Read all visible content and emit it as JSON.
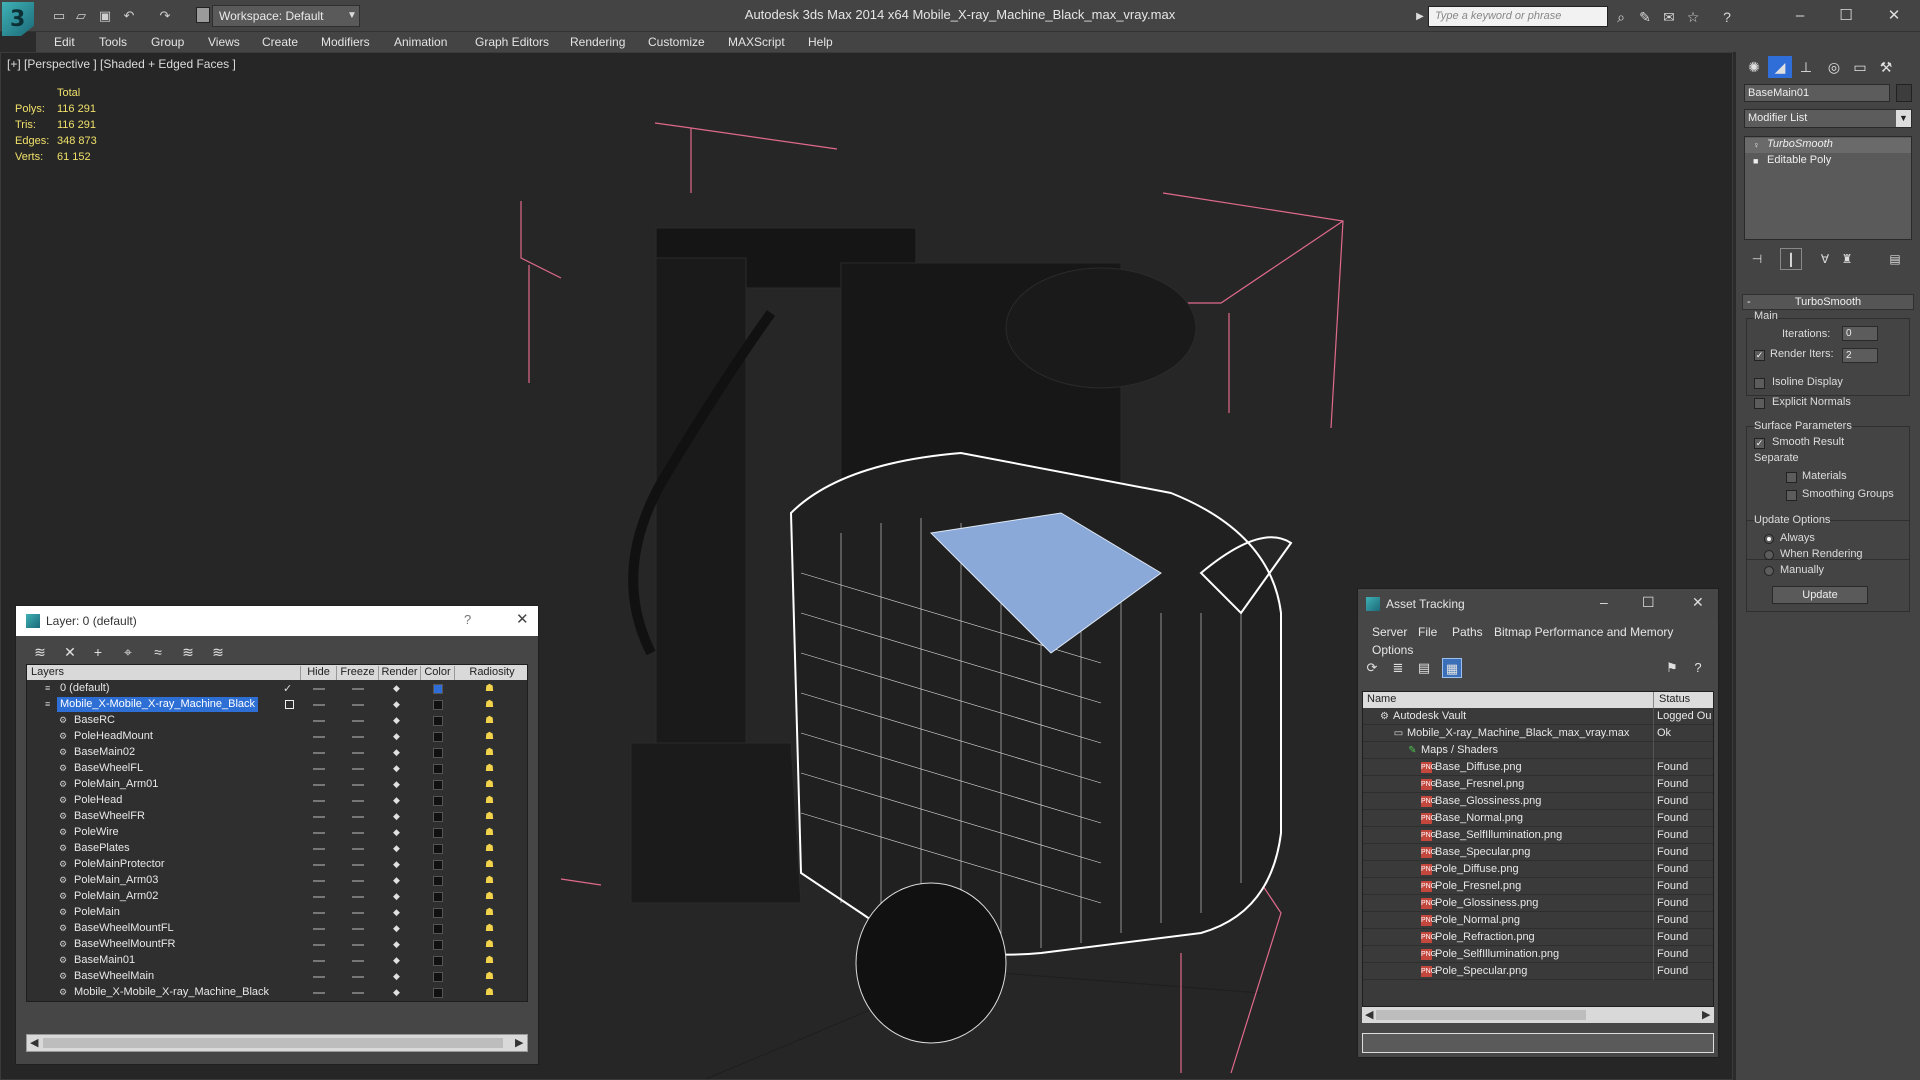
{
  "app": {
    "title": "Autodesk 3ds Max  2014 x64      Mobile_X-ray_Machine_Black_max_vray.max",
    "logo_glyph": "3",
    "workspace": "Workspace: Default",
    "search_placeholder": "Type a keyword or phrase"
  },
  "menu": [
    "Edit",
    "Tools",
    "Group",
    "Views",
    "Create",
    "Modifiers",
    "Animation",
    "Graph Editors",
    "Rendering",
    "Customize",
    "MAXScript",
    "Help"
  ],
  "viewport": {
    "label": "[+] [Perspective ] [Shaded + Edged Faces ]",
    "stats": {
      "header": "Total",
      "rows": [
        {
          "key": "Polys:",
          "value": "116 291"
        },
        {
          "key": "Tris:",
          "value": "116 291"
        },
        {
          "key": "Edges:",
          "value": "348 873"
        },
        {
          "key": "Verts:",
          "value": "61 152"
        }
      ]
    }
  },
  "command_panel": {
    "object_name": "BaseMain01",
    "modifier_list": "Modifier List",
    "stack": [
      {
        "name": "TurboSmooth",
        "active": true
      },
      {
        "name": "Editable Poly",
        "active": false
      }
    ],
    "turbosmooth": {
      "title": "TurboSmooth",
      "main_group": "Main",
      "iterations_label": "Iterations:",
      "iterations_value": "0",
      "render_iters_label": "Render Iters:",
      "render_iters_value": "2",
      "render_iters_checked": true,
      "isoline_label": "Isoline Display",
      "explicit_normals_label": "Explicit Normals",
      "surface_group": "Surface Parameters",
      "smooth_result_label": "Smooth Result",
      "separate_label": "Separate",
      "materials_label": "Materials",
      "smoothing_groups_label": "Smoothing Groups",
      "update_group": "Update Options",
      "always_label": "Always",
      "when_rendering_label": "When Rendering",
      "manually_label": "Manually",
      "update_button": "Update"
    }
  },
  "layer_dialog": {
    "title": "Layer: 0 (default)",
    "help": "?",
    "columns": [
      "Layers",
      "Hide",
      "Freeze",
      "Render",
      "Color",
      "Radiosity"
    ],
    "rows": [
      {
        "name": "0 (default)",
        "level": 0,
        "kind": "layer",
        "current": true,
        "color": "#2f6ed8"
      },
      {
        "name": "Mobile_X-Mobile_X-ray_Machine_Black",
        "level": 0,
        "kind": "layer",
        "selected": true,
        "color": "#111111"
      },
      {
        "name": "BaseRC",
        "level": 1,
        "kind": "object",
        "color": "#111111"
      },
      {
        "name": "PoleHeadMount",
        "level": 1,
        "kind": "object",
        "color": "#111111"
      },
      {
        "name": "BaseMain02",
        "level": 1,
        "kind": "object",
        "color": "#111111"
      },
      {
        "name": "BaseWheelFL",
        "level": 1,
        "kind": "object",
        "color": "#111111"
      },
      {
        "name": "PoleMain_Arm01",
        "level": 1,
        "kind": "object",
        "color": "#111111"
      },
      {
        "name": "PoleHead",
        "level": 1,
        "kind": "object",
        "color": "#111111"
      },
      {
        "name": "BaseWheelFR",
        "level": 1,
        "kind": "object",
        "color": "#111111"
      },
      {
        "name": "PoleWire",
        "level": 1,
        "kind": "object",
        "color": "#111111"
      },
      {
        "name": "BasePlates",
        "level": 1,
        "kind": "object",
        "color": "#111111"
      },
      {
        "name": "PoleMainProtector",
        "level": 1,
        "kind": "object",
        "color": "#111111"
      },
      {
        "name": "PoleMain_Arm03",
        "level": 1,
        "kind": "object",
        "color": "#111111"
      },
      {
        "name": "PoleMain_Arm02",
        "level": 1,
        "kind": "object",
        "color": "#111111"
      },
      {
        "name": "PoleMain",
        "level": 1,
        "kind": "object",
        "color": "#111111"
      },
      {
        "name": "BaseWheelMountFL",
        "level": 1,
        "kind": "object",
        "color": "#111111"
      },
      {
        "name": "BaseWheelMountFR",
        "level": 1,
        "kind": "object",
        "color": "#111111"
      },
      {
        "name": "BaseMain01",
        "level": 1,
        "kind": "object",
        "color": "#111111"
      },
      {
        "name": "BaseWheelMain",
        "level": 1,
        "kind": "object",
        "color": "#111111"
      },
      {
        "name": "Mobile_X-Mobile_X-ray_Machine_Black",
        "level": 1,
        "kind": "object",
        "color": "#111111"
      }
    ]
  },
  "asset_dialog": {
    "title": "Asset Tracking",
    "menu": [
      "Server",
      "File",
      "Paths",
      "Bitmap Performance and Memory",
      "Options"
    ],
    "columns": [
      "Name",
      "Status"
    ],
    "rows": [
      {
        "name": "Autodesk Vault",
        "status": "Logged Ou",
        "level": 0,
        "kind": "vault"
      },
      {
        "name": "Mobile_X-ray_Machine_Black_max_vray.max",
        "status": "Ok",
        "level": 1,
        "kind": "file"
      },
      {
        "name": "Maps / Shaders",
        "status": "",
        "level": 2,
        "kind": "folder"
      },
      {
        "name": "Base_Diffuse.png",
        "status": "Found",
        "level": 3,
        "kind": "png"
      },
      {
        "name": "Base_Fresnel.png",
        "status": "Found",
        "level": 3,
        "kind": "png"
      },
      {
        "name": "Base_Glossiness.png",
        "status": "Found",
        "level": 3,
        "kind": "png"
      },
      {
        "name": "Base_Normal.png",
        "status": "Found",
        "level": 3,
        "kind": "png"
      },
      {
        "name": "Base_SelfIllumination.png",
        "status": "Found",
        "level": 3,
        "kind": "png"
      },
      {
        "name": "Base_Specular.png",
        "status": "Found",
        "level": 3,
        "kind": "png"
      },
      {
        "name": "Pole_Diffuse.png",
        "status": "Found",
        "level": 3,
        "kind": "png"
      },
      {
        "name": "Pole_Fresnel.png",
        "status": "Found",
        "level": 3,
        "kind": "png"
      },
      {
        "name": "Pole_Glossiness.png",
        "status": "Found",
        "level": 3,
        "kind": "png"
      },
      {
        "name": "Pole_Normal.png",
        "status": "Found",
        "level": 3,
        "kind": "png"
      },
      {
        "name": "Pole_Refraction.png",
        "status": "Found",
        "level": 3,
        "kind": "png"
      },
      {
        "name": "Pole_SelfIllumination.png",
        "status": "Found",
        "level": 3,
        "kind": "png"
      },
      {
        "name": "Pole_Specular.png",
        "status": "Found",
        "level": 3,
        "kind": "png"
      }
    ]
  }
}
